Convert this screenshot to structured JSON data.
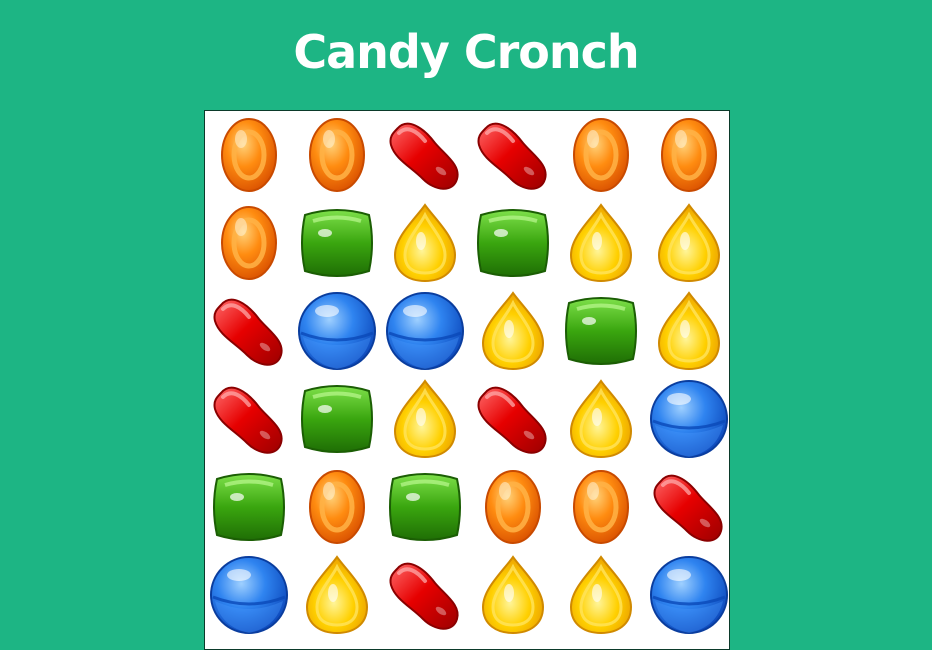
{
  "title": "Candy Cronch",
  "colors": {
    "background": "#1db584",
    "board": "#ffffff",
    "orange": "#ff7a00",
    "green": "#2e9e07",
    "yellow": "#ffc400",
    "red": "#e00000",
    "blue": "#1e6fe8"
  },
  "board": {
    "rows": [
      [
        "orange",
        "orange",
        "red",
        "red",
        "orange",
        "orange"
      ],
      [
        "orange",
        "green",
        "yellow",
        "green",
        "yellow",
        "yellow"
      ],
      [
        "red",
        "blue",
        "blue",
        "yellow",
        "green",
        "yellow"
      ],
      [
        "red",
        "green",
        "yellow",
        "red",
        "yellow",
        "blue"
      ],
      [
        "green",
        "orange",
        "green",
        "orange",
        "orange",
        "red"
      ],
      [
        "blue",
        "yellow",
        "red",
        "yellow",
        "yellow",
        "blue"
      ]
    ]
  }
}
